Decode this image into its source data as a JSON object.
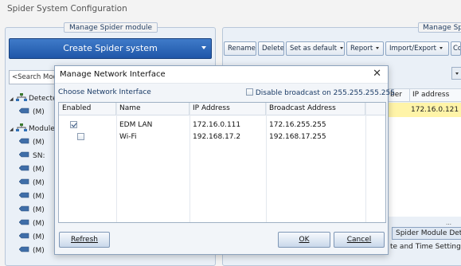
{
  "app": {
    "title": "Spider System Configuration"
  },
  "left_panel": {
    "title": "Manage Spider module",
    "create_button": "Create Spider system",
    "search_text": "<Search Mod",
    "tree": [
      {
        "kind": "group",
        "label": "Detecte",
        "icon": "network-icon"
      },
      {
        "kind": "device",
        "label": "(M)",
        "icon": "device-icon"
      },
      {
        "kind": "group",
        "label": "Module",
        "icon": "network-icon"
      },
      {
        "kind": "device",
        "label": "(M)",
        "icon": "device-icon"
      },
      {
        "kind": "device",
        "label": "SN:",
        "icon": "device-icon"
      },
      {
        "kind": "device",
        "label": "(M)",
        "icon": "device-icon"
      },
      {
        "kind": "device",
        "label": "(M)",
        "icon": "device-icon"
      },
      {
        "kind": "device",
        "label": "(M)",
        "icon": "device-icon"
      },
      {
        "kind": "device",
        "label": "(M)",
        "icon": "device-icon"
      },
      {
        "kind": "device",
        "label": "(M)",
        "icon": "device-icon"
      },
      {
        "kind": "device",
        "label": "(M)",
        "icon": "device-icon"
      },
      {
        "kind": "device",
        "label": "(M)",
        "icon": "device-icon"
      }
    ]
  },
  "right_panel": {
    "title": "Manage Sp",
    "toolbar": {
      "rename": "Rename",
      "delete": "Delete",
      "set_default": "Set as default",
      "report": "Report",
      "import_export": "Import/Export",
      "more": "Co"
    },
    "columns": {
      "number": "ber",
      "ip": "IP address"
    },
    "selected_row_ip": "172.16.0.121",
    "detail_tab": "Spider Module Det",
    "datetime_label": "te and Time Setting"
  },
  "dialog": {
    "title": "Manage Network Interface",
    "close_glyph": "✕",
    "subtitle": "Choose Network Interface",
    "disable_broadcast_label": "Disable broadcast on 255.255.255.255",
    "columns": {
      "enabled": "Enabled",
      "name": "Name",
      "ip": "IP Address",
      "broadcast": "Broadcast Address"
    },
    "rows": [
      {
        "enabled": true,
        "name": "EDM LAN",
        "ip": "172.16.0.111",
        "broadcast": "172.16.255.255"
      },
      {
        "enabled": false,
        "name": "Wi-Fi",
        "ip": "192.168.17.2",
        "broadcast": "192.168.17.255"
      }
    ],
    "refresh_button": "Refresh",
    "ok_button": "OK",
    "cancel_button": "Cancel"
  }
}
